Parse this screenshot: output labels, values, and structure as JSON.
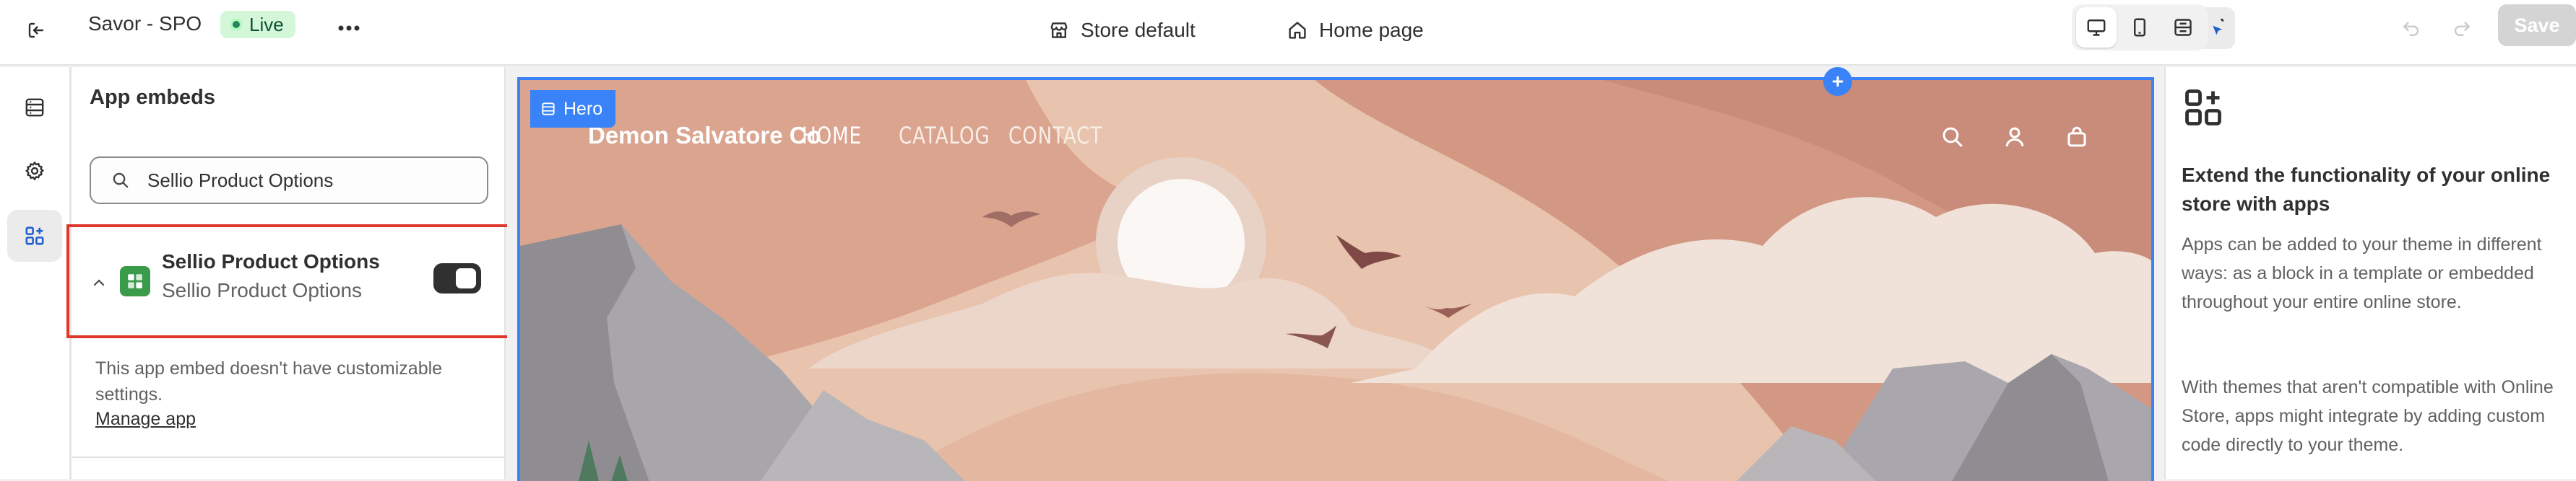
{
  "topbar": {
    "title": "Savor - SPO",
    "status_label": "Live",
    "store_selector": "Store default",
    "page_selector": "Home page",
    "save_label": "Save"
  },
  "sidebar": {
    "title": "App embeds",
    "search": {
      "value": "Sellio Product Options",
      "placeholder": "Search"
    },
    "embed": {
      "name": "Sellio Product Options",
      "subtitle": "Sellio Product Options",
      "enabled": true
    },
    "note": "This app embed doesn't have customizable settings.",
    "manage_link": "Manage app"
  },
  "preview": {
    "section_tag": "Hero",
    "store_name": "Demon Salvatore Co",
    "nav": [
      "HOME",
      "CATALOG",
      "CONTACT"
    ]
  },
  "right_panel": {
    "title": "Extend the functionality of your online store with apps",
    "paragraph1": "Apps can be added to your theme in different ways: as a block in a template or embedded throughout your entire online store.",
    "paragraph2": "With themes that aren't compatible with Online Store, apps might integrate by adding custom code directly to your theme."
  },
  "colors": {
    "accent_blue": "#3a82f7",
    "live_badge_bg": "#d5f7d9",
    "highlight_red": "#e0362b",
    "app_icon_green": "#3a9b4b"
  },
  "icons": {
    "exit": "exit-icon",
    "more": "more-horizontal-icon",
    "store": "store-icon",
    "home": "home-icon",
    "sections": "sections-icon",
    "settings": "gear-icon",
    "apps": "apps-icon",
    "search": "search-icon",
    "inspector": "inspector-icon",
    "select": "cursor-select-icon",
    "desktop": "desktop-icon",
    "mobile": "mobile-icon",
    "fullwidth": "fullscreen-icon",
    "undo": "undo-icon",
    "redo": "redo-icon"
  }
}
